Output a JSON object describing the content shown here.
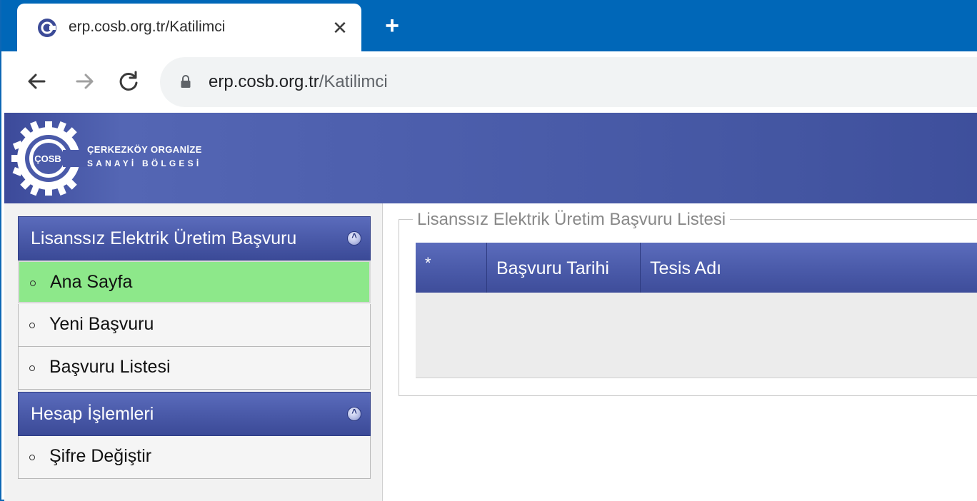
{
  "browser": {
    "tab_title": "erp.cosb.org.tr/Katilimci",
    "close_glyph": "✕",
    "new_tab_glyph": "+",
    "url_host": "erp.cosb.org.tr",
    "url_path": "/Katilimci",
    "accent_color": "#0067b8"
  },
  "header": {
    "logo_badge": "ÇOSB",
    "logo_line1": "ÇERKEZKÖY ORGANİZE",
    "logo_line2": "SANAYİ BÖLGESİ"
  },
  "sidebar": {
    "panels": [
      {
        "title": "Lisanssız Elektrik Üretim Başvuru",
        "items": [
          {
            "label": "Ana Sayfa",
            "active": true
          },
          {
            "label": "Yeni Başvuru",
            "active": false
          },
          {
            "label": "Başvuru Listesi",
            "active": false
          }
        ]
      },
      {
        "title": "Hesap İşlemleri",
        "items": [
          {
            "label": "Şifre Değiştir",
            "active": false
          }
        ]
      }
    ],
    "active_color": "#8de88a",
    "header_color": "#4a5aa9"
  },
  "main": {
    "legend": "Lisanssız Elektrik Üretim Başvuru Listesi",
    "grid": {
      "columns": [
        "*",
        "Başvuru Tarihi",
        "Tesis Adı"
      ],
      "rows": []
    }
  }
}
